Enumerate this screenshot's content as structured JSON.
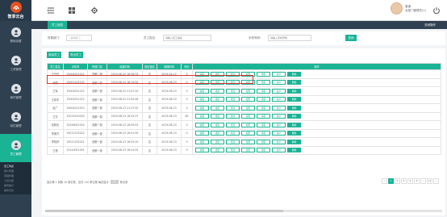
{
  "app": {
    "logo_text": "智享云台"
  },
  "sidebar": {
    "items": [
      {
        "label": "基础设置",
        "icon": "home-icon"
      },
      {
        "label": "工资管理",
        "icon": "user-icon"
      },
      {
        "label": "案件管理",
        "icon": "user-icon"
      },
      {
        "label": "岗位管理",
        "icon": "user-icon"
      },
      {
        "label": "员工管理",
        "icon": "user-icon",
        "active": true
      }
    ],
    "subitems": [
      "员工列表",
      "客户管理",
      "营销管理",
      "人员分配",
      "账号统计",
      "操作日志"
    ]
  },
  "topbar": {
    "user_name": "普通",
    "user_role": "全部门管理员(1)"
  },
  "tabbar": {
    "active_tab": "员工信息",
    "right_label": "关闭操作"
  },
  "filters": {
    "dept_label": "所属部门:",
    "dept_value": "--选择部门--",
    "name_label": "员工姓名:",
    "name_placeholder": "请输入员工姓名",
    "phone_label": "手机号码:",
    "phone_placeholder": "请输入手机号码",
    "search_label": "查询"
  },
  "actions": {
    "add_label": "添加员工",
    "export_label": "导出员工"
  },
  "table": {
    "headers": [
      "员工姓名",
      "手机号",
      "所属门店",
      "创建时间",
      "是否锁定",
      "到期时间",
      "积分",
      "操作"
    ],
    "ops": [
      "编辑",
      "锁定",
      "修改",
      "权限",
      "离职",
      "客户",
      "删除"
    ],
    "rows": [
      [
        "王丹丹",
        "15004021021",
        "西都一部",
        "2019-08-24 16:36:33",
        "否",
        "2019-04-12",
        "3"
      ],
      [
        "张顺",
        "15002102102",
        "西都一部",
        "2019-08-24 18:19:00",
        "否",
        "2019-08-23",
        "0"
      ],
      [
        "王军",
        "15004021022",
        "西都一部",
        "2019-08-23 21:07:20",
        "否",
        "2019-08-23",
        "0"
      ],
      [
        "王晓冬",
        "15004021012",
        "西都一部",
        "2019-08-23 21:05:46",
        "否",
        "2019-08-23",
        "0"
      ],
      [
        "赵广",
        "15004221023",
        "西都一部",
        "2019-08-23 21:47:50",
        "否",
        "2019-08-23",
        "0"
      ],
      [
        "王宇",
        "15015210020",
        "西都一部",
        "2019-08-23 16:43:37",
        "否",
        "2019-08-23",
        "60"
      ],
      [
        "张新民",
        "15246021024",
        "西都一部",
        "2019-08-23 16:50:02",
        "否",
        "2019-08-23",
        "0"
      ],
      [
        "李美杰",
        "15012122022",
        "西都一部",
        "2019-08-23 16:51:00",
        "否",
        "2019-08-23",
        "0"
      ],
      [
        "李晓婷",
        "15011202021",
        "西都一部",
        "2019-08-23 16:53:20",
        "否",
        "2019-08-23",
        "0"
      ],
      [
        "王艳",
        "15120021001",
        "西都一部",
        "2019-08-23 16:24:25",
        "否",
        "2019-08-23",
        "0"
      ]
    ]
  },
  "footer": {
    "pre": "显示第 1 到第 10 条记录，总共 110 条记录 每页显示",
    "per_page": "10",
    "post": "条记录"
  },
  "pager": {
    "pages": [
      "‹",
      "1",
      "2",
      "3",
      "4",
      "5",
      "...",
      "11",
      "›"
    ],
    "active": "1"
  }
}
